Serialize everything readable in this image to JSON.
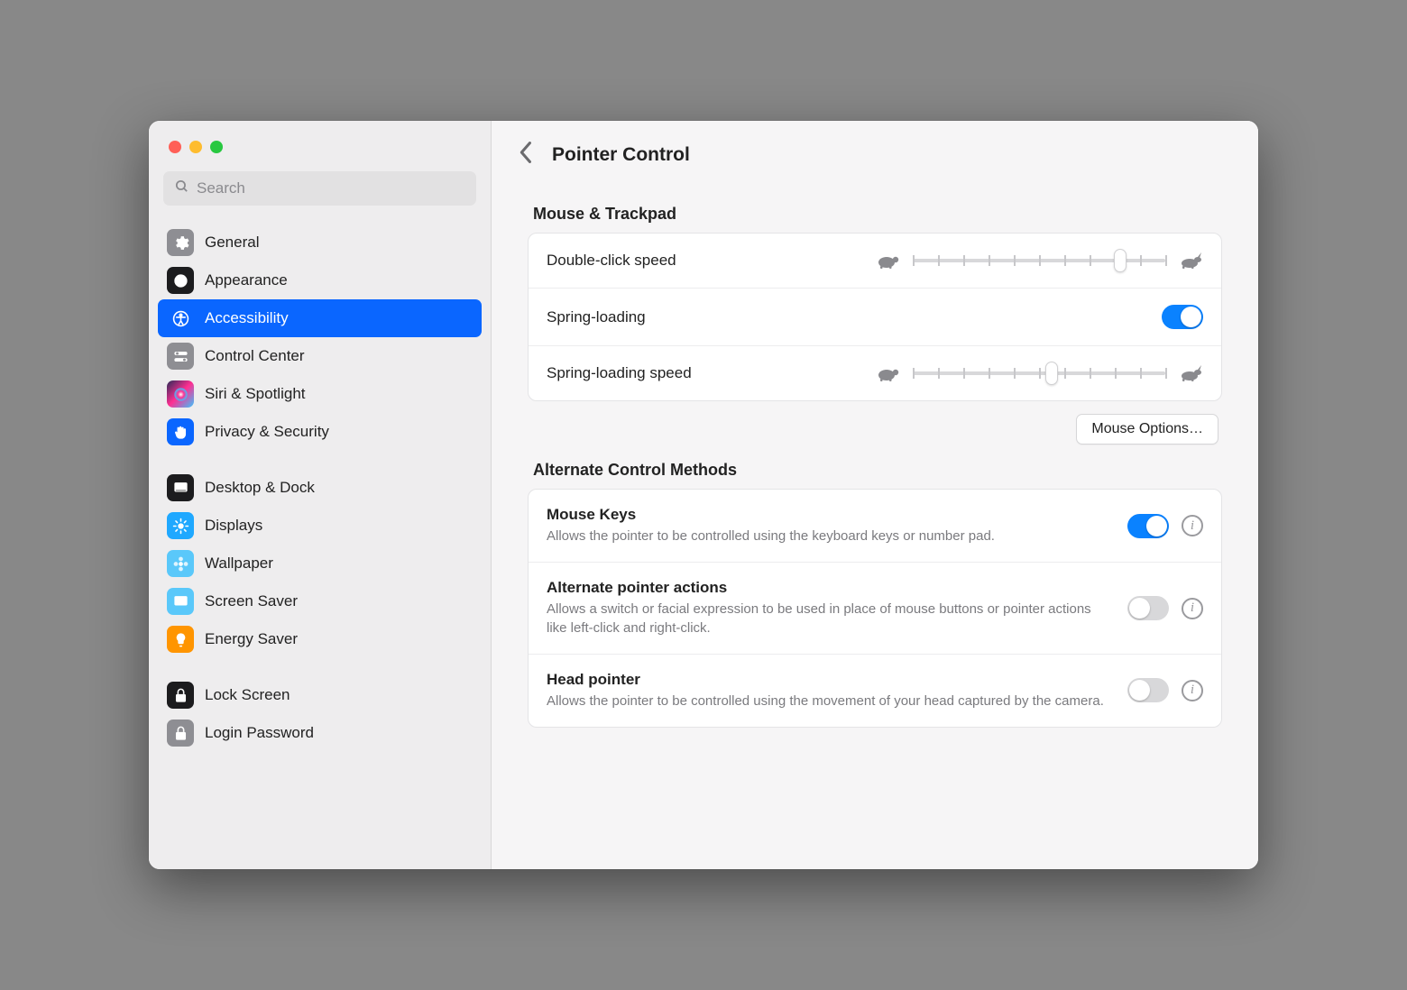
{
  "search": {
    "placeholder": "Search"
  },
  "sidebar": {
    "groups": [
      {
        "items": [
          {
            "label": "General",
            "icon": "gear-icon",
            "bg": "#8e8e93",
            "fg": "#fff"
          },
          {
            "label": "Appearance",
            "icon": "appearance-icon",
            "bg": "#1c1c1e",
            "fg": "#fff"
          },
          {
            "label": "Accessibility",
            "icon": "accessibility-icon",
            "bg": "#0a66ff",
            "fg": "#fff",
            "selected": true
          },
          {
            "label": "Control Center",
            "icon": "switches-icon",
            "bg": "#8e8e93",
            "fg": "#fff"
          },
          {
            "label": "Siri & Spotlight",
            "icon": "siri-icon",
            "bg": "linear-gradient(135deg,#2b2b58,#ff2f92,#39c5ff)",
            "fg": "#fff"
          },
          {
            "label": "Privacy & Security",
            "icon": "hand-icon",
            "bg": "#0a66ff",
            "fg": "#fff"
          }
        ]
      },
      {
        "items": [
          {
            "label": "Desktop & Dock",
            "icon": "dock-icon",
            "bg": "#1c1c1e",
            "fg": "#fff"
          },
          {
            "label": "Displays",
            "icon": "sun-icon",
            "bg": "#1fa8ff",
            "fg": "#fff"
          },
          {
            "label": "Wallpaper",
            "icon": "flower-icon",
            "bg": "#5ac8fa",
            "fg": "#fff"
          },
          {
            "label": "Screen Saver",
            "icon": "screensaver-icon",
            "bg": "#5ac8fa",
            "fg": "#fff"
          },
          {
            "label": "Energy Saver",
            "icon": "bulb-icon",
            "bg": "#ff9500",
            "fg": "#fff"
          }
        ]
      },
      {
        "items": [
          {
            "label": "Lock Screen",
            "icon": "lock-icon",
            "bg": "#1c1c1e",
            "fg": "#fff"
          },
          {
            "label": "Login Password",
            "icon": "key-icon",
            "bg": "#8e8e93",
            "fg": "#fff"
          }
        ]
      }
    ]
  },
  "header": {
    "title": "Pointer Control"
  },
  "sections": {
    "mouse_trackpad": {
      "title": "Mouse & Trackpad",
      "rows": {
        "double_click": {
          "label": "Double-click speed",
          "value_pct": 82
        },
        "spring_loading": {
          "label": "Spring-loading",
          "on": true
        },
        "spring_speed": {
          "label": "Spring-loading speed",
          "value_pct": 55
        }
      },
      "mouse_options_btn": "Mouse Options…"
    },
    "alt_methods": {
      "title": "Alternate Control Methods",
      "rows": {
        "mouse_keys": {
          "label": "Mouse Keys",
          "desc": "Allows the pointer to be controlled using the keyboard keys or number pad.",
          "on": true
        },
        "alt_pointer": {
          "label": "Alternate pointer actions",
          "desc": "Allows a switch or facial expression to be used in place of mouse buttons or pointer actions like left-click and right-click.",
          "on": false
        },
        "head_pointer": {
          "label": "Head pointer",
          "desc": "Allows the pointer to be controlled using the movement of your head captured by the camera.",
          "on": false
        }
      }
    }
  },
  "slider_ticks": 10
}
